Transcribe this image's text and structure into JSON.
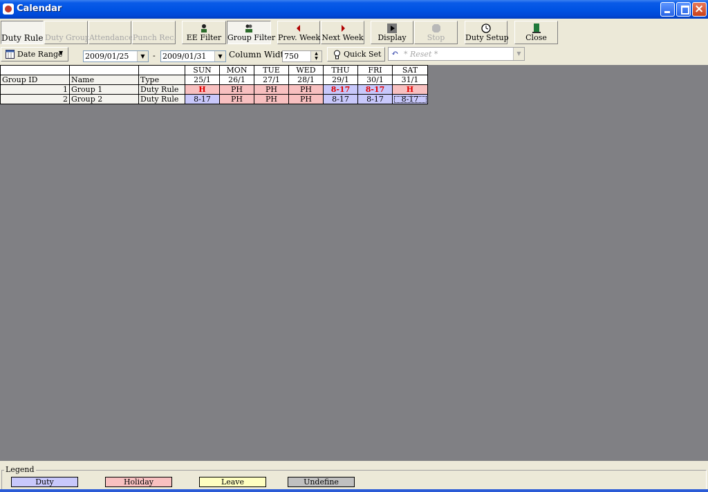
{
  "window": {
    "title": "Calendar"
  },
  "toolbar": {
    "duty_rule": "Duty Rule",
    "duty_group": "Duty Group",
    "attendance": "Attendance",
    "punch_rec": "Punch Rec.",
    "ee_filter": "EE Filter",
    "group_filter": "Group Filter",
    "prev_week": "Prev. Week",
    "next_week": "Next Week",
    "display": "Display",
    "stop": "Stop",
    "duty_setup": "Duty Setup",
    "close": "Close"
  },
  "filters": {
    "date_range_label": "Date Range",
    "date_from": "2009/01/25",
    "date_sep": "-",
    "date_to": "2009/01/31",
    "column_width_label": "Column Width",
    "column_width_value": "750",
    "quick_set": "Quick Set",
    "reset_value": "* Reset *"
  },
  "grid": {
    "col_group_id": "Group ID",
    "col_name": "Name",
    "col_type": "Type",
    "days": [
      {
        "dow": "SUN",
        "date": "25/1"
      },
      {
        "dow": "MON",
        "date": "26/1"
      },
      {
        "dow": "TUE",
        "date": "27/1"
      },
      {
        "dow": "WED",
        "date": "28/1"
      },
      {
        "dow": "THU",
        "date": "29/1"
      },
      {
        "dow": "FRI",
        "date": "30/1"
      },
      {
        "dow": "SAT",
        "date": "31/1"
      }
    ],
    "rows": [
      {
        "id": "1",
        "name": "Group 1",
        "type": "Duty Rule",
        "cells": [
          {
            "v": "H",
            "kind": "hol",
            "red": true
          },
          {
            "v": "PH",
            "kind": "hol",
            "red": false
          },
          {
            "v": "PH",
            "kind": "hol",
            "red": false
          },
          {
            "v": "PH",
            "kind": "hol",
            "red": false
          },
          {
            "v": "8-17",
            "kind": "duty",
            "red": true
          },
          {
            "v": "8-17",
            "kind": "duty",
            "red": true
          },
          {
            "v": "H",
            "kind": "hol",
            "red": true
          }
        ]
      },
      {
        "id": "2",
        "name": "Group 2",
        "type": "Duty Rule",
        "cells": [
          {
            "v": "8-17",
            "kind": "duty",
            "red": false
          },
          {
            "v": "PH",
            "kind": "hol",
            "red": false
          },
          {
            "v": "PH",
            "kind": "hol",
            "red": false
          },
          {
            "v": "PH",
            "kind": "hol",
            "red": false
          },
          {
            "v": "8-17",
            "kind": "duty",
            "red": false
          },
          {
            "v": "8-17",
            "kind": "duty",
            "red": false
          },
          {
            "v": "8-17",
            "kind": "duty",
            "red": false
          }
        ]
      }
    ]
  },
  "legend": {
    "title": "Legend",
    "items": [
      {
        "label": "Duty",
        "color": "#c8c8fb"
      },
      {
        "label": "Holiday",
        "color": "#f8c0c0"
      },
      {
        "label": "Leave",
        "color": "#ffffc0"
      },
      {
        "label": "Undefine",
        "color": "#c0c0c0"
      }
    ]
  },
  "colors": {
    "grid_bg": "#808084",
    "titlebar": "#0053e3",
    "holiday_text": "#e00000"
  }
}
